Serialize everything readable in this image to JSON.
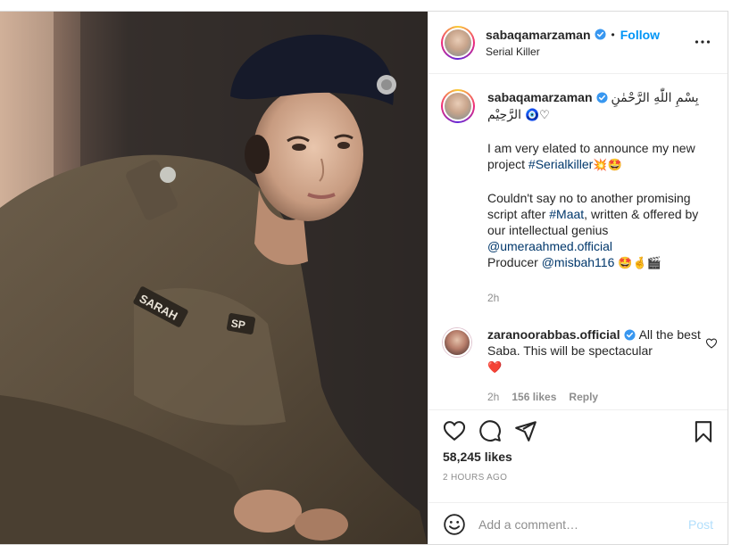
{
  "colors": {
    "accent": "#0095f6",
    "link": "#00376b",
    "muted": "#8e8e8e",
    "text": "#262626",
    "heart_red": "#ed4956"
  },
  "header": {
    "username": "sabaqamarzaman",
    "verified_icon": "verified-badge-icon",
    "separator": "•",
    "follow_label": "Follow",
    "subtitle": "Serial Killer",
    "more_icon": "more-options-icon"
  },
  "caption": {
    "username": "sabaqamarzaman",
    "arabic": "بِسْمِ اللّٰهِ الرَّحْمٰنِ الرَّحِيْم",
    "arabic_emojis": "🧿♡",
    "line1_text": "I am very elated to announce my new project ",
    "line1_hashtag": "#Serialkiller",
    "line1_emojis": "💥🤩",
    "line2_text": "Couldn't say no to another promising script after ",
    "line2_hashtag": "#Maat",
    "line2_rest": ", written & offered by our intellectual genius",
    "mention1": "@umeraahmed.official",
    "producer_label": "Producer ",
    "mention2": "@misbah116",
    "producer_emojis": "🤩🤞🎬",
    "time": "2h"
  },
  "reply": {
    "username": "zaranoorabbas.official",
    "text": "All the best Saba. This will be spectacular",
    "emoji": "❤️",
    "time": "2h",
    "likes": "156 likes",
    "reply_label": "Reply"
  },
  "actions": {
    "like_icon": "heart-icon",
    "comment_icon": "comment-icon",
    "share_icon": "share-icon",
    "save_icon": "bookmark-icon"
  },
  "likes_count": "58,245 likes",
  "posted_ago": "2 HOURS AGO",
  "comment_input": {
    "placeholder": "Add a comment…",
    "value": "",
    "post_label": "Post"
  }
}
